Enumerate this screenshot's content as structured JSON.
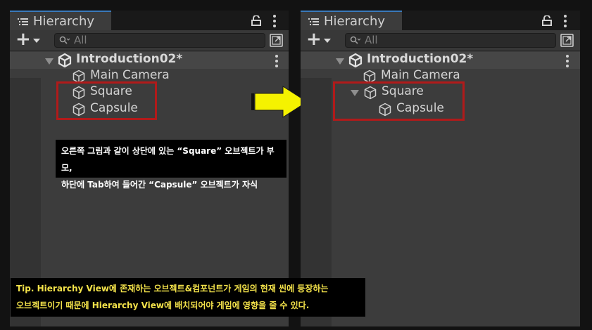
{
  "colors": {
    "panel_bg": "#3c3c3c",
    "tab_accent": "#3a79bb",
    "highlight_border": "#b11a1a",
    "arrow_fill": "#f5f200",
    "tip_text": "#f3e24a"
  },
  "left_panel": {
    "tab_title": "Hierarchy",
    "search_placeholder": "All",
    "scene_name": "Introduction02*",
    "items": [
      {
        "label": "Main Camera",
        "icon": "cube-icon"
      },
      {
        "label": "Square",
        "icon": "cube-icon"
      },
      {
        "label": "Capsule",
        "icon": "cube-icon"
      }
    ]
  },
  "right_panel": {
    "tab_title": "Hierarchy",
    "search_placeholder": "All",
    "scene_name": "Introduction02*",
    "items": [
      {
        "label": "Main Camera",
        "icon": "cube-icon"
      },
      {
        "label": "Square",
        "icon": "cube-icon",
        "expanded": true
      },
      {
        "label": "Capsule",
        "icon": "cube-icon",
        "child_of": "Square"
      }
    ]
  },
  "captions": {
    "middle_line1": "오른쪽 그림과 같이 상단에 있는 “Square” 오브젝트가 부모,",
    "middle_line2": "하단에 Tab하여 들어간 “Capsule” 오브젝트가 자식",
    "tip_line1": "Tip. Hierarchy View에 존재하는 오브젝트&컴포넌트가 게임의 현재 씬에 등장하는",
    "tip_line2": "오브젝트이기 때문에 Hierarchy View에 배치되어야 게임에 영향을 줄 수 있다."
  }
}
